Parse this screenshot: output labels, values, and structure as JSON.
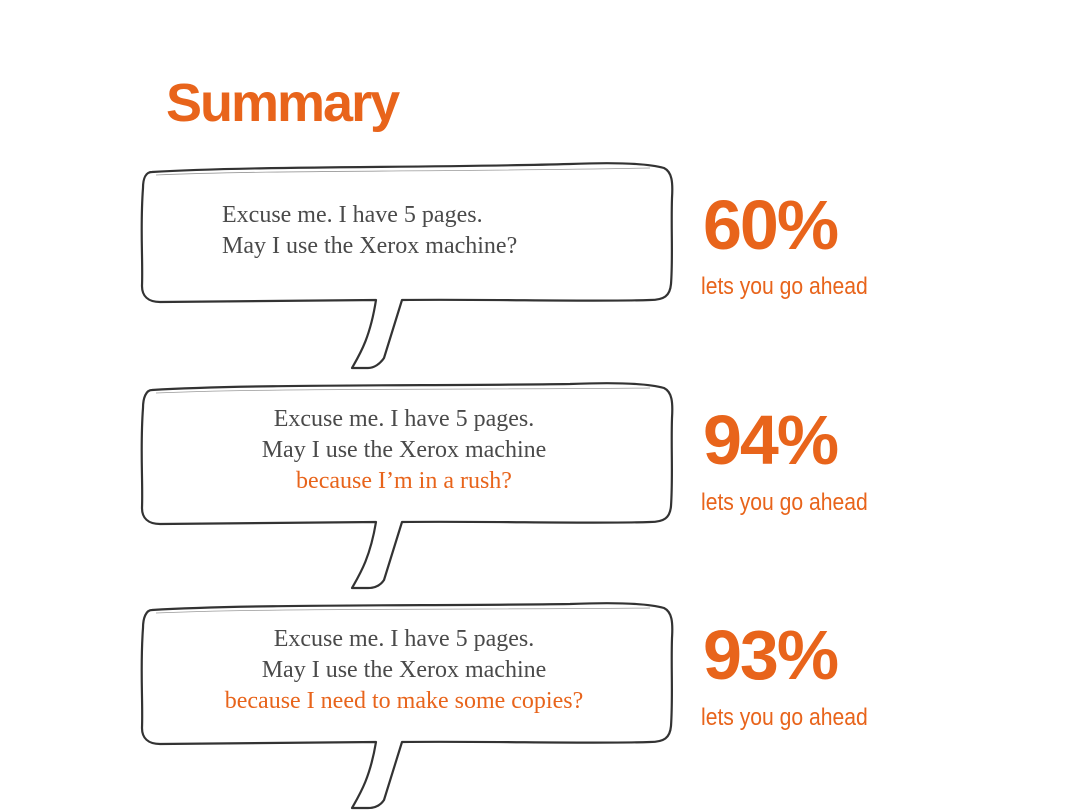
{
  "title": "Summary",
  "colors": {
    "accent": "#e8641b",
    "text": "#4a4a4a",
    "outline": "#333333"
  },
  "panels": [
    {
      "lines": [
        "Excuse me. I have 5 pages.",
        "May I use the Xerox machine?"
      ],
      "reason": "",
      "percent": "60%",
      "caption": "lets you go ahead"
    },
    {
      "lines": [
        "Excuse me. I have 5 pages.",
        "May I use the Xerox machine"
      ],
      "reason": "because I’m in a rush?",
      "percent": "94%",
      "caption": "lets you go ahead"
    },
    {
      "lines": [
        "Excuse me. I have 5 pages.",
        "May I use the Xerox machine"
      ],
      "reason": "because I need to make some copies?",
      "percent": "93%",
      "caption": "lets you go ahead"
    }
  ]
}
